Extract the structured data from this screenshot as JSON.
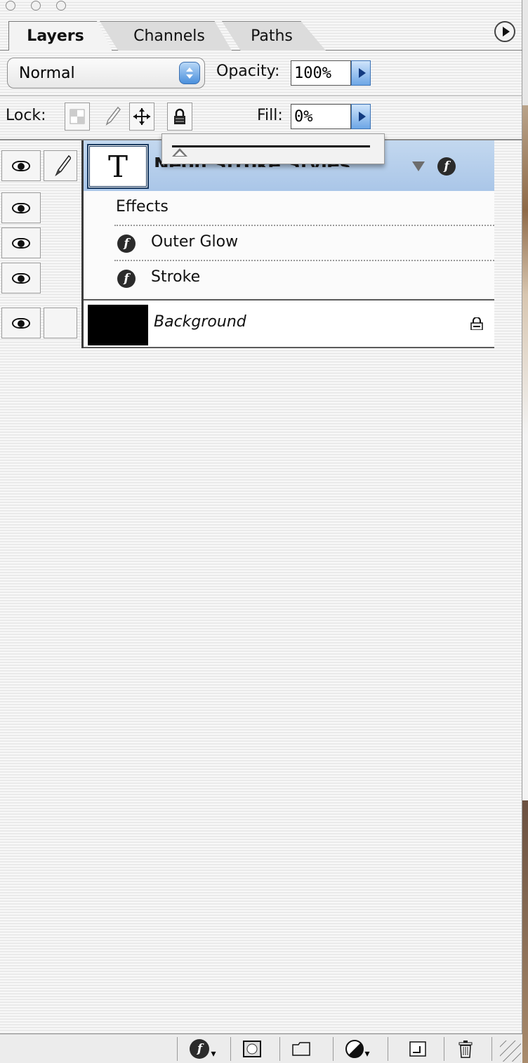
{
  "window": {
    "buttons": [
      "close",
      "minimize",
      "zoom"
    ]
  },
  "tabs": [
    {
      "label": "Layers",
      "active": true
    },
    {
      "label": "Channels",
      "active": false
    },
    {
      "label": "Paths",
      "active": false
    }
  ],
  "blend_mode": {
    "value": "Normal"
  },
  "opacity": {
    "label": "Opacity:",
    "value": "100%"
  },
  "lock": {
    "label": "Lock:",
    "icons": [
      "lock-transparency-icon",
      "lock-paint-icon",
      "lock-position-icon",
      "lock-all-icon"
    ]
  },
  "fill": {
    "label": "Fill:",
    "value": "0%",
    "slider_fraction": 0.0
  },
  "layers": [
    {
      "name": "Neon Stroke Styles",
      "type": "text",
      "thumb_glyph": "T",
      "selected": true,
      "visible": true,
      "effects_header": "Effects",
      "effects": [
        "Outer Glow",
        "Stroke"
      ]
    },
    {
      "name": "Background",
      "type": "background",
      "visible": true,
      "locked": true
    }
  ],
  "fx_symbol": "f",
  "bottom_toolbar": [
    "layer-style-icon",
    "layer-mask-icon",
    "new-set-icon",
    "adjustment-layer-icon",
    "new-layer-icon",
    "trash-icon"
  ],
  "colors": {
    "selected_row": "#aac6e8",
    "accent_blue": "#4a8fdc"
  }
}
